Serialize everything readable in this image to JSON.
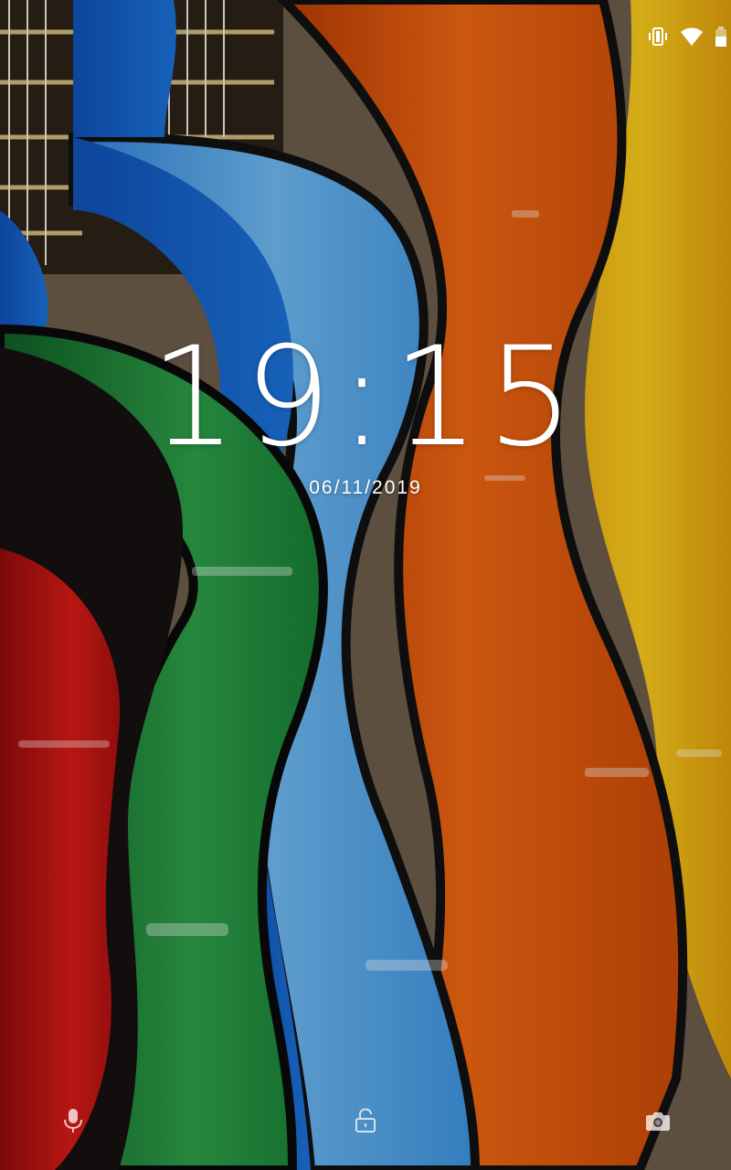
{
  "lockscreen": {
    "time": "19:15",
    "date": "06/11/2019"
  },
  "status_bar": {
    "icons": [
      "vibrate-icon",
      "wifi-icon",
      "battery-icon"
    ]
  },
  "bottom_actions": {
    "left": "microphone-icon",
    "center": "lock-icon",
    "right": "camera-icon"
  },
  "colors": {
    "text": "#ffffff",
    "guitar_red": "#c21414",
    "guitar_green": "#1f8a3a",
    "guitar_blue": "#1c6fd1",
    "guitar_light_blue": "#4ea3e6",
    "guitar_orange": "#e35a12",
    "guitar_yellow": "#f0c018"
  }
}
